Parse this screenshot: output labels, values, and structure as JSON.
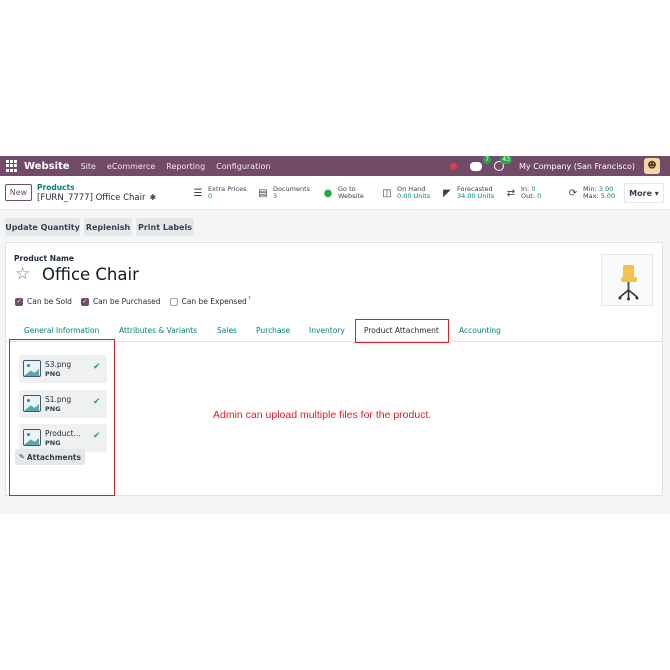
{
  "navbar": {
    "brand": "Website",
    "menu": [
      "Site",
      "eCommerce",
      "Reporting",
      "Configuration"
    ],
    "chat_badge": "7",
    "activity_badge": "43",
    "company": "My Company (San Francisco)"
  },
  "control_panel": {
    "new_label": "New",
    "breadcrumb_parent": "Products",
    "breadcrumb_current": "[FURN_7777] Office Chair",
    "stats": {
      "extra_prices": {
        "label": "Extra Prices",
        "value": "0"
      },
      "documents": {
        "label": "Documents",
        "value": "3"
      },
      "website": {
        "label": "Go to",
        "value": "Website"
      },
      "on_hand": {
        "label": "On Hand",
        "value": "0.00 Units"
      },
      "forecasted": {
        "label": "Forecasted",
        "value": "34.00 Units"
      },
      "in_out": {
        "in_label": "In:",
        "in_value": "0",
        "out_label": "Out:",
        "out_value": "0"
      },
      "min_max": {
        "min_label": "Min:",
        "min_value": "3.00",
        "max_label": "Max:",
        "max_value": "5.00"
      }
    },
    "more_label": "More ▾"
  },
  "actions": {
    "update_quantity": "Update Quantity",
    "replenish": "Replenish",
    "print_labels": "Print Labels"
  },
  "product": {
    "name_label": "Product Name",
    "name": "Office Chair",
    "can_be_sold": "Can be Sold",
    "can_be_purchased": "Can be Purchased",
    "can_be_expensed": "Can be Expensed",
    "tooltip_mark": "?"
  },
  "tabs": [
    {
      "label": "General Information"
    },
    {
      "label": "Attributes & Variants"
    },
    {
      "label": "Sales"
    },
    {
      "label": "Purchase"
    },
    {
      "label": "Inventory"
    },
    {
      "label": "Product Attachment",
      "active": true
    },
    {
      "label": "Accounting"
    }
  ],
  "attachments": [
    {
      "name": "S3.png",
      "type": "PNG"
    },
    {
      "name": "S1.png",
      "type": "PNG"
    },
    {
      "name": "Product...",
      "type": "PNG"
    }
  ],
  "attach_button": "Attachments",
  "note": "Admin can upload multiple files for the product.",
  "colors": {
    "brand": "#714b67",
    "accent": "#017e84",
    "annotation": "#e31b23",
    "success": "#28a745"
  }
}
